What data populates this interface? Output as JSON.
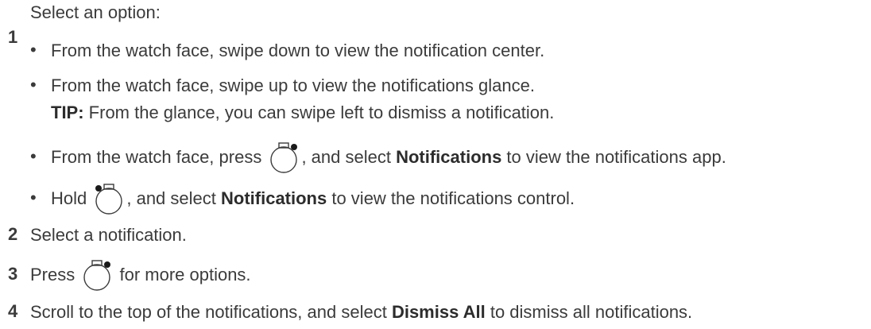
{
  "steps": [
    {
      "number": "1",
      "intro": "Select an option:",
      "options": [
        {
          "text": "From the watch face, swipe down to view the notification center."
        },
        {
          "text": "From the watch face, swipe up to view the notifications glance."
        },
        {
          "tip_label": "TIP:",
          "tip_text": " From the glance, you can swipe left to dismiss a notification."
        },
        {
          "pre": "From the watch face, press ",
          "mid": ", and select ",
          "bold": "Notifications",
          "post": " to view the notifications app.",
          "icon": "watch-button-top-right-icon"
        },
        {
          "pre": "Hold ",
          "mid": ", and select ",
          "bold": "Notifications",
          "post": " to view the notifications control.",
          "icon": "watch-button-top-left-icon"
        }
      ]
    },
    {
      "number": "2",
      "text": "Select a notification."
    },
    {
      "number": "3",
      "pre": "Press ",
      "post": " for more options.",
      "icon": "watch-button-top-right-icon"
    },
    {
      "number": "4",
      "pre": "Scroll to the top of the notifications, and select ",
      "bold": "Dismiss All",
      "post": " to dismiss all notifications."
    }
  ],
  "bullet_char": "•"
}
